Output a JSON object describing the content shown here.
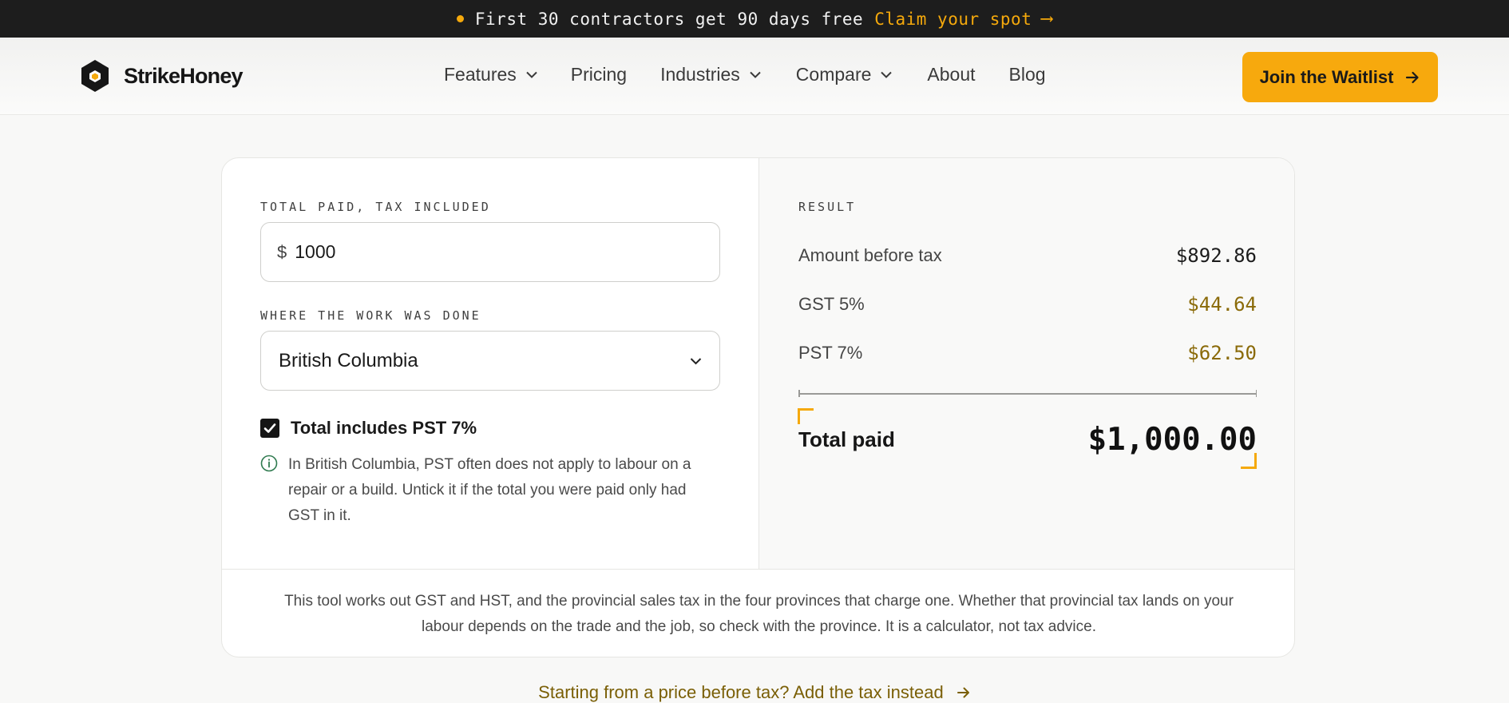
{
  "announcement": {
    "text": "First 30 contractors get 90 days free",
    "link_label": "Claim your spot",
    "link_arrow": "⟶",
    "dot_color": "#f5a90c"
  },
  "header": {
    "brand": "StrikeHoney",
    "logo_icon": "hexagon-honeycomb-icon",
    "nav": [
      {
        "label": "Features",
        "dropdown": true
      },
      {
        "label": "Pricing",
        "dropdown": false
      },
      {
        "label": "Industries",
        "dropdown": true
      },
      {
        "label": "Compare",
        "dropdown": true
      },
      {
        "label": "About",
        "dropdown": false
      },
      {
        "label": "Blog",
        "dropdown": false
      }
    ],
    "cta_label": "Join the Waitlist",
    "accent_color": "#f7a90d"
  },
  "form": {
    "total_label": "TOTAL PAID, TAX INCLUDED",
    "currency_symbol": "$",
    "total_value": "1000",
    "location_label": "WHERE THE WORK WAS DONE",
    "location_value": "British Columbia",
    "pst_checkbox_label": "Total includes PST 7%",
    "pst_checked": true,
    "info_text": "In British Columbia, PST often does not apply to labour on a repair or a build. Untick it if the total you were paid only had GST in it."
  },
  "result": {
    "label": "RESULT",
    "rows": [
      {
        "name": "Amount before tax",
        "value": "$892.86"
      },
      {
        "name": "GST 5%",
        "value": "$44.64"
      },
      {
        "name": "PST 7%",
        "value": "$62.50"
      }
    ],
    "total_label": "Total paid",
    "total_value": "$1,000.00"
  },
  "disclaimer": "This tool works out GST and HST, and the provincial sales tax in the four provinces that charge one. Whether that provincial tax lands on your labour depends on the trade and the job, so check with the province. It is a calculator, not tax advice.",
  "bottom_link": "Starting from a price before tax? Add the tax instead"
}
